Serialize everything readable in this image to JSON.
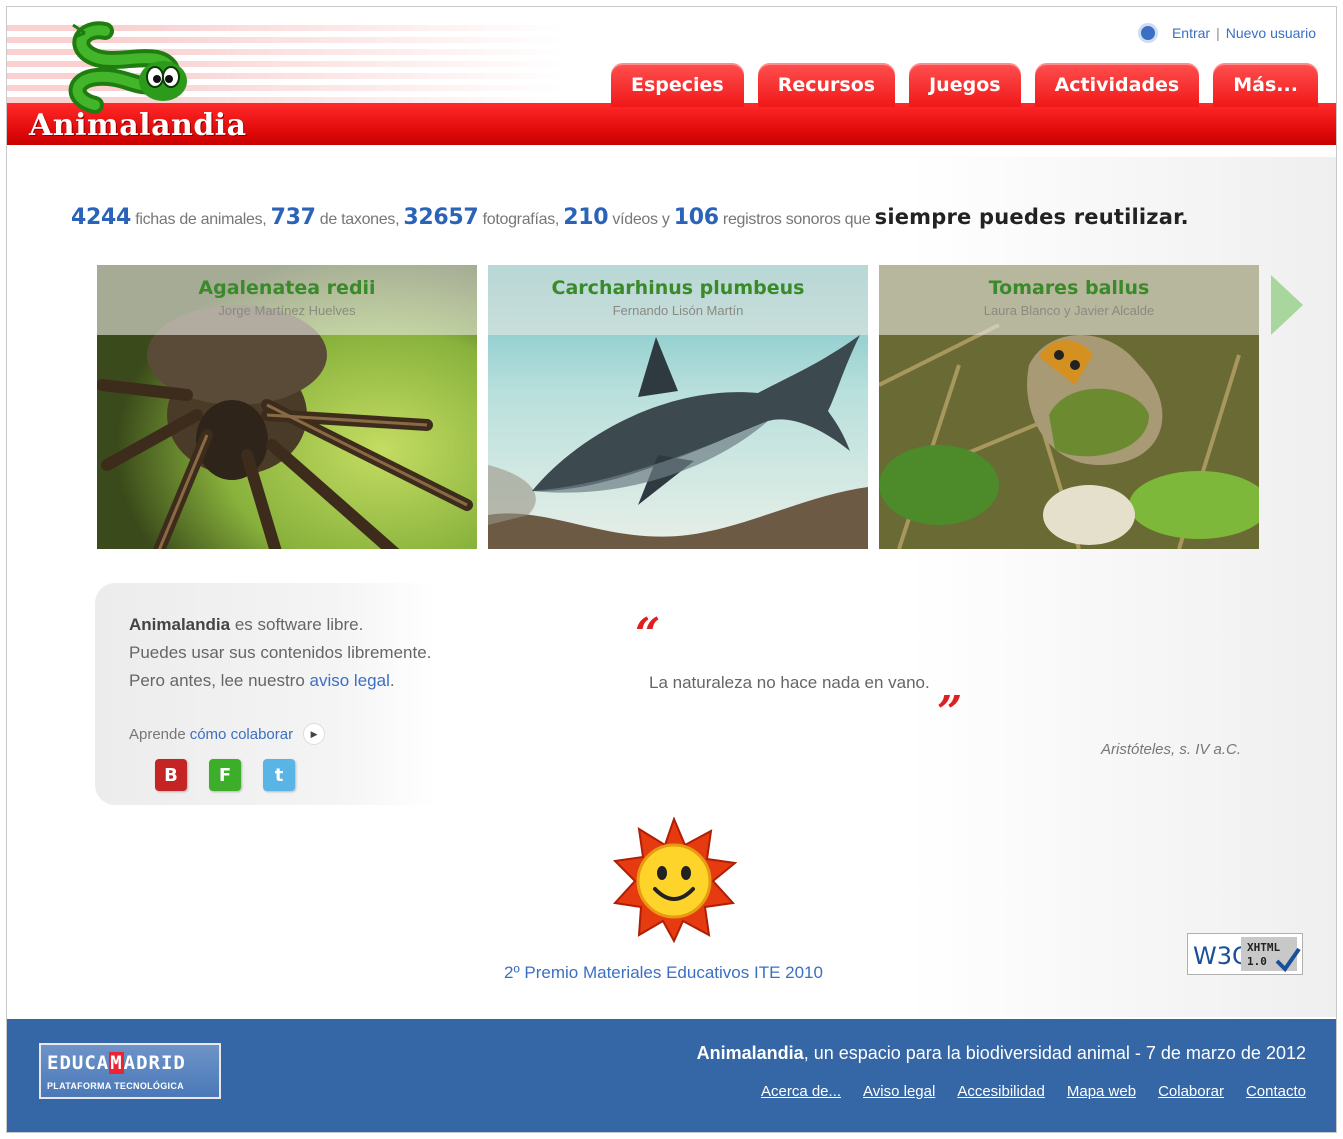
{
  "header": {
    "logo_text": "Animalandia",
    "links": {
      "login": "Entrar",
      "separator": "|",
      "new_user": "Nuevo usuario"
    },
    "tabs": [
      "Especies",
      "Recursos",
      "Juegos",
      "Actividades",
      "Más..."
    ]
  },
  "stats": {
    "fichas_num": "4244",
    "fichas_text": "fichas de animales,",
    "taxones_num": "737",
    "taxones_text": "de taxones,",
    "fotos_num": "32657",
    "fotos_text": "fotografías,",
    "videos_num": "210",
    "videos_text": "vídeos y",
    "sonidos_num": "106",
    "sonidos_text": "registros sonoros que",
    "highlight": "siempre puedes reutilizar."
  },
  "gallery": [
    {
      "species": "Agalenatea redii",
      "author": "Jorge Martínez Huelves"
    },
    {
      "species": "Carcharhinus plumbeus",
      "author": "Fernando Lisón Martín"
    },
    {
      "species": "Tomares ballus",
      "author": "Laura Blanco y Javier Alcalde"
    }
  ],
  "info": {
    "name": "Animalandia",
    "line1_rest": " es software libre.",
    "line2": "Puedes usar sus contenidos libremente.",
    "line3_pre": "Pero antes, lee nuestro ",
    "legal_link": "aviso legal",
    "line3_post": ".",
    "learn_pre": "Aprende",
    "learn_link": "cómo colaborar",
    "social": [
      "B",
      "F",
      "t"
    ]
  },
  "quote": {
    "open": "“",
    "text": "La naturaleza no hace nada en vano.",
    "close": "”",
    "author": "Aristóteles, s. IV a.C."
  },
  "award": {
    "label": "2º Premio Materiales Educativos ITE 2010"
  },
  "w3c": {
    "left": "W3C",
    "badge_top": "XHTML",
    "badge_bottom": "1.0"
  },
  "footer": {
    "edu_pre": "EDUCA",
    "edu_m": "M",
    "edu_post": "ADRID",
    "edu_sub": "PLATAFORMA TECNOLÓGICA",
    "tag_bold": "Animalandia",
    "tag_rest": ", un espacio para la biodiversidad animal - 7 de marzo de 2012",
    "links": [
      "Acerca de...",
      "Aviso legal",
      "Accesibilidad",
      "Mapa web",
      "Colaborar",
      "Contacto"
    ]
  },
  "colors": {
    "brand_red": "#e50d0d",
    "link_blue": "#3b6fc4",
    "footer_blue": "#3566a6",
    "species_green": "#3a8a2a"
  }
}
